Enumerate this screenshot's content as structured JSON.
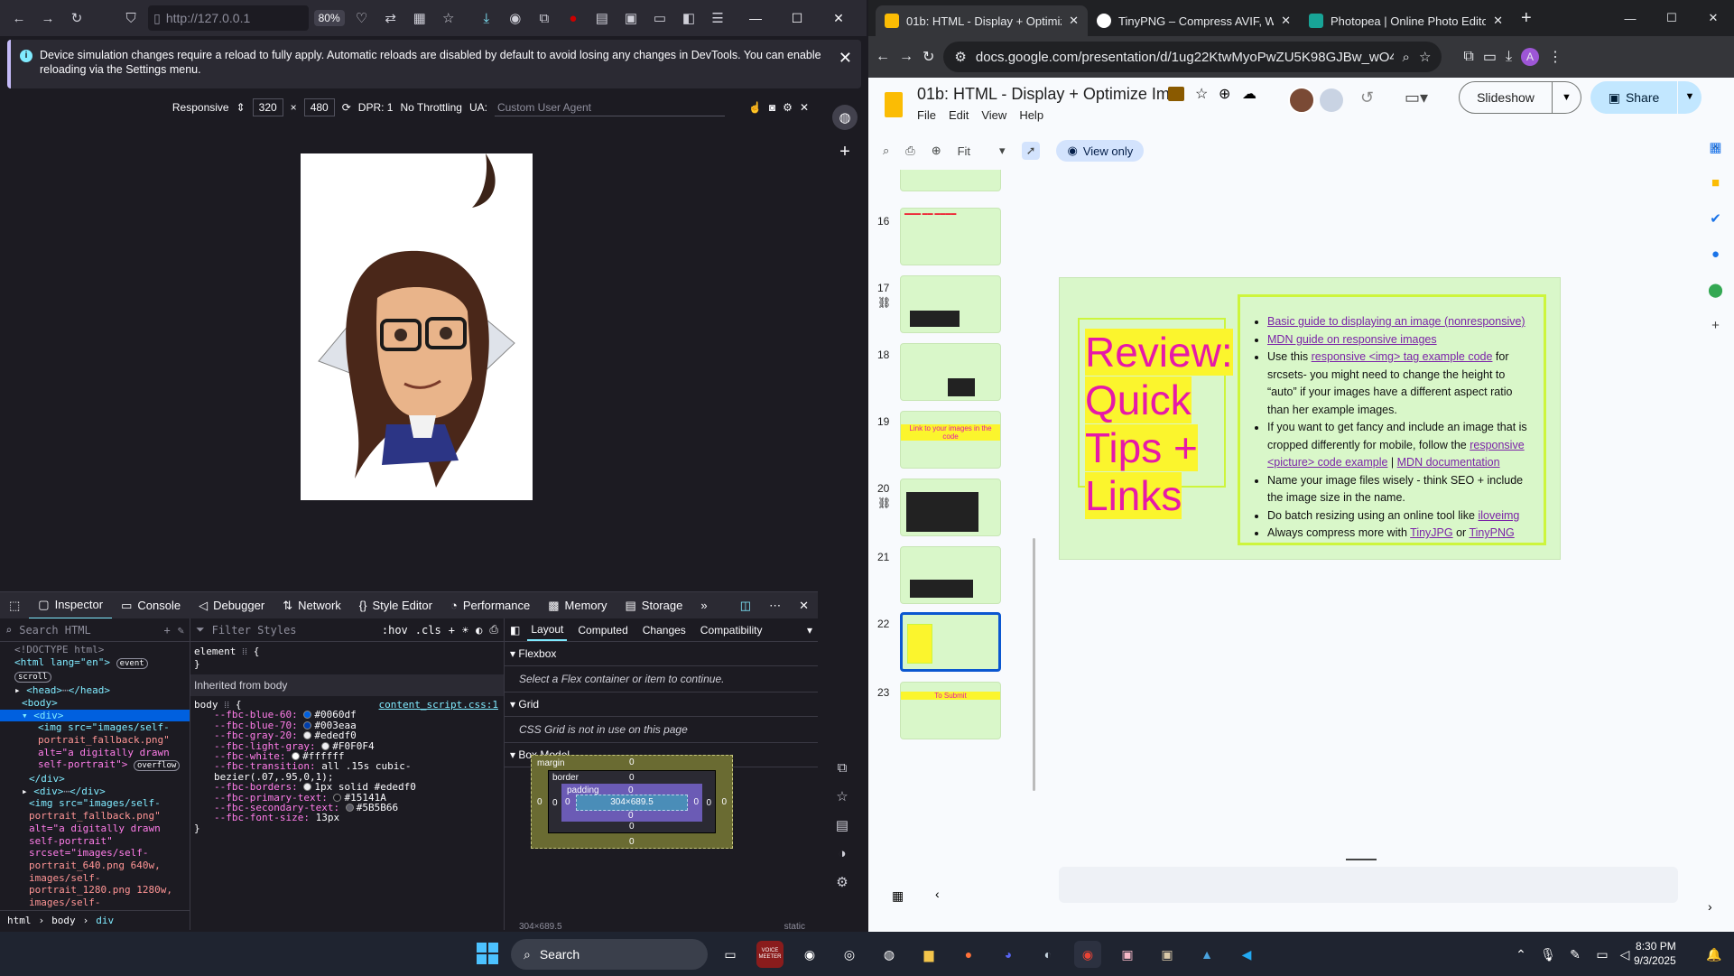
{
  "firefox": {
    "url": "http://127.0.0.1",
    "zoom": "80%",
    "notice": "Device simulation changes require a reload to fully apply. Automatic reloads are disabled by default to avoid losing any changes in DevTools. You can enable reloading via the Settings menu.",
    "rdm": {
      "device": "Responsive",
      "width": "320",
      "times": "×",
      "height": "480",
      "dpr": "DPR: 1",
      "throttle": "No Throttling",
      "ua_label": "UA:",
      "ua_placeholder": "Custom User Agent"
    },
    "devtools_tabs": [
      "Inspector",
      "Console",
      "Debugger",
      "Network",
      "Style Editor",
      "Performance",
      "Memory",
      "Storage"
    ],
    "inspector": {
      "search_placeholder": "Search HTML",
      "lines": [
        "<!DOCTYPE html>",
        "<html lang=\"en\">",
        "<head>",
        "</head>",
        "<body>",
        "<div>",
        "<img src=\"images/self-",
        "portrait_fallback.png\"",
        "alt=\"a digitally drawn",
        "self-portrait\">",
        "</div>",
        "<div>",
        "</div>",
        "<img src=\"images/self-",
        "portrait_fallback.png\"",
        "alt=\"a digitally drawn",
        "self-portrait\"",
        "srcset=\"images/self-",
        "portrait_640.png 640w,",
        "images/self-",
        "portrait_1280.png 1280w,",
        "images/self-"
      ],
      "badge_event": "event",
      "badge_scroll": "scroll",
      "badge_overflow": "overflow",
      "crumbs": [
        "html",
        "body",
        "div"
      ]
    },
    "rules": {
      "filter_placeholder": "Filter Styles",
      "hov": ":hov",
      "cls": ".cls",
      "element": "element",
      "inherited": "Inherited from body",
      "selector": "body",
      "source": "content_script.css:1",
      "vars": [
        {
          "name": "--fbc-blue-60:",
          "value": "#0060df",
          "color": "#0060df"
        },
        {
          "name": "--fbc-blue-70:",
          "value": "#003eaa",
          "color": "#003eaa"
        },
        {
          "name": "--fbc-gray-20:",
          "value": "#ededf0",
          "color": "#ededf0"
        },
        {
          "name": "--fbc-light-gray:",
          "value": "#F0F0F4",
          "color": "#F0F0F4"
        },
        {
          "name": "--fbc-white:",
          "value": "#ffffff",
          "color": "#ffffff"
        },
        {
          "name": "--fbc-transition:",
          "value": "all .15s cubic-",
          "color": ""
        },
        {
          "name": "",
          "value": "bezier(.07,.95,0,1);",
          "color": ""
        },
        {
          "name": "--fbc-borders:",
          "value": "1px solid #ededf0",
          "color": "#ededf0"
        },
        {
          "name": "--fbc-primary-text:",
          "value": "#15141A",
          "color": "#15141A"
        },
        {
          "name": "--fbc-secondary-text:",
          "value": "#5B5B66",
          "color": "#5B5B66"
        },
        {
          "name": "--fbc-font-size:",
          "value": "13px",
          "color": ""
        }
      ]
    },
    "layout": {
      "tabs": [
        "Layout",
        "Computed",
        "Changes",
        "Compatibility"
      ],
      "flexbox": "Flexbox",
      "flex_msg": "Select a Flex container or item to continue.",
      "grid": "Grid",
      "grid_msg": "CSS Grid is not in use on this page",
      "boxmodel": "Box Model",
      "margin": "margin",
      "border": "border",
      "padding": "padding",
      "content": "304×689.5",
      "zero": "0",
      "footer_left": "304×689.5",
      "footer_right": "static"
    }
  },
  "chrome": {
    "tabs": [
      {
        "label": "01b: HTML - Display + Optimize",
        "color": "#fbbc04"
      },
      {
        "label": "TinyPNG – Compress AVIF, WebP",
        "color": "#ffffff"
      },
      {
        "label": "Photopea | Online Photo Editor",
        "color": "#18a497"
      }
    ],
    "url": "docs.google.com/presentation/d/1ug22KtwMyoPwZU5K98GJBw_wO4L-022TD...",
    "profile": "A",
    "slides": {
      "title": "01b: HTML - Display + Optimize Im...",
      "menu": [
        "File",
        "Edit",
        "View",
        "Help"
      ],
      "slideshow": "Slideshow",
      "share": "Share",
      "zoom": "Fit",
      "view_only": "View only",
      "thumb_numbers": [
        "16",
        "17",
        "18",
        "19",
        "20",
        "21",
        "22",
        "23"
      ],
      "thumb_19_text": "Link to your images in the code",
      "thumb_23_text": "To Submit",
      "slide_title": "Review: Quick Tips + Links",
      "bullets": [
        {
          "a": "Basic guide to displaying an image (nonresponsive)"
        },
        {
          "a": "MDN guide on responsive images"
        },
        {
          "pre": "Use this ",
          "a": "responsive <img> tag example code",
          "post": " for srcsets- you might need to change the height to “auto” if your images have a different aspect ratio than her example images."
        },
        {
          "pre": "If you want to get fancy and include an image that is cropped differently for mobile, follow the ",
          "a": "responsive <picture> code example",
          "mid": " | ",
          "a2": "MDN documentation"
        },
        {
          "pre": "Name your image files wisely - think SEO + include the image size in the name."
        },
        {
          "pre": "Do batch resizing using an online tool like ",
          "a": "iloveimg"
        },
        {
          "pre": "Always compress more with ",
          "a": "TinyJPG",
          "mid": " or ",
          "a2": "TinyPNG"
        }
      ]
    }
  },
  "taskbar": {
    "search": "Search",
    "time": "8:30 PM",
    "date": "9/3/2025",
    "voice_badge": "VOICE MEETER"
  }
}
